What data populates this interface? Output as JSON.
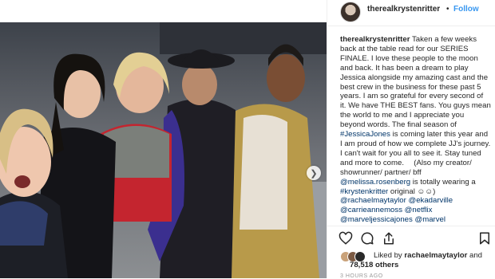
{
  "header": {
    "username": "therealkrystenritter",
    "separator": "•",
    "follow_label": "Follow"
  },
  "caption": {
    "username": "therealkrystenritter",
    "lines": [
      " Taken a few weeks",
      "back at the table read for our SERIES",
      "FINALE. I love these people to the moon",
      "and back. It has been a dream to play",
      "Jessica alongside my amazing cast and the",
      "best crew in the business for these past 5",
      "years. I am so grateful for every second of",
      "it. We have THE BEST fans. You guys mean",
      "the world to me and I appreciate you",
      "beyond words. The final season of",
      "#JessicaJones",
      " is coming later this year and",
      "I am proud of how we complete JJ's journey.",
      "I can't wait for you all to see it. Stay tuned",
      "and more to come.  (Also my creator/",
      "showrunner/ partner/ bff",
      "@melissa.rosenberg",
      " is totally wearing a",
      "#krystenkritter",
      " original ☺☺)",
      "@rachaelmaytaylor",
      "@ekadarville",
      "@carrieannemoss",
      "@netflix",
      "@marveljessicajones",
      "@marvel"
    ]
  },
  "likes": {
    "prefix": "Liked by ",
    "user": "rachaelmaytaylor",
    "and": " and",
    "count": "78,518 others"
  },
  "timestamp": "3 HOURS AGO",
  "icons": {
    "next": "chevron-right",
    "like": "heart-outline",
    "comment": "speech-bubble",
    "share": "upload-arrow",
    "save": "bookmark"
  }
}
